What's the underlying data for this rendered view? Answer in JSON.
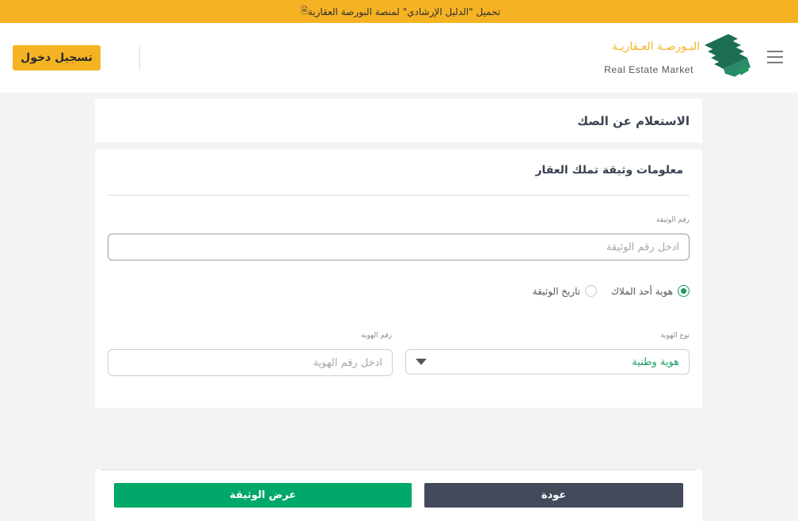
{
  "announcement": {
    "text": "تحميل \"الدليل الإرشادي\" لمنصة البورصة العقارية",
    "icon": "document-icon"
  },
  "header": {
    "login_label": "تسجيل دخول",
    "logo_arabic": "البـورصـة العـقاريـة",
    "logo_english": "Real Estate Market",
    "brand_colors": {
      "gold": "#f5b324",
      "green": "#1c9b61",
      "dark": "#3a4352"
    }
  },
  "page": {
    "title": "الاستعلام عن الصك"
  },
  "form": {
    "section_title": "معلومات وثيقة تملك العقار",
    "doc_number": {
      "label": "رقم الوثيقة",
      "placeholder": "ادخل رقم الوثيقة",
      "value": ""
    },
    "search_by": {
      "options": [
        {
          "label": "هوية أحد الملاك",
          "selected": true
        },
        {
          "label": "تاريخ الوثيقة",
          "selected": false
        }
      ]
    },
    "id_type": {
      "label": "نوع الهوية",
      "value": "هوية وطنية"
    },
    "id_number": {
      "label": "رقم الهوية",
      "placeholder": "ادخل رقم الهوية",
      "value": ""
    }
  },
  "footer": {
    "view_label": "عرض الوثيقة",
    "back_label": "عودة"
  }
}
